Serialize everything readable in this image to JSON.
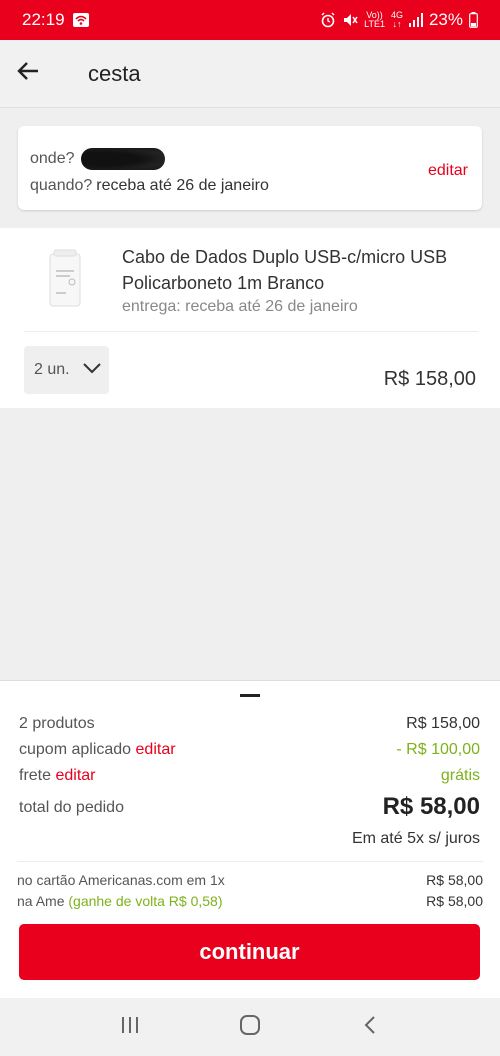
{
  "status_bar": {
    "time": "22:19",
    "lte_top": "Vo))",
    "lte_bottom": "LTE1",
    "net_top": "4G",
    "net_bottom": "↓↑",
    "battery": "23%"
  },
  "app_bar": {
    "title": "cesta"
  },
  "delivery": {
    "where_label": "onde?",
    "when_label": "quando?",
    "when_value": "receba até 26 de janeiro",
    "edit_label": "editar"
  },
  "product": {
    "name": "Cabo de Dados Duplo USB-c/micro USB Policarboneto 1m Branco",
    "delivery": "entrega: receba até 26 de janeiro",
    "quantity": "2 un.",
    "price": "R$ 158,00"
  },
  "summary": {
    "products_label": "2 produtos",
    "products_value": "R$ 158,00",
    "coupon_label": "cupom aplicado",
    "coupon_edit": "editar",
    "coupon_value": "- R$ 100,00",
    "shipping_label": "frete",
    "shipping_edit": "editar",
    "shipping_value": "grátis",
    "total_label": "total do pedido",
    "total_value": "R$ 58,00",
    "installments": "Em até 5x s/ juros",
    "card_label": "no cartão Americanas.com em 1x",
    "card_value": "R$ 58,00",
    "ame_label": "na Ame",
    "ame_cashback": "(ganhe de volta R$ 0,58)",
    "ame_value": "R$ 58,00",
    "continue_label": "continuar"
  },
  "colors": {
    "brand_red": "#e8001c",
    "green": "#7db21a"
  },
  "icons": [
    "wifi-icon",
    "alarm-icon",
    "mute-icon",
    "signal-icon",
    "battery-icon",
    "back-arrow-icon",
    "chevron-down-icon",
    "recents-icon",
    "home-icon",
    "back-icon"
  ]
}
